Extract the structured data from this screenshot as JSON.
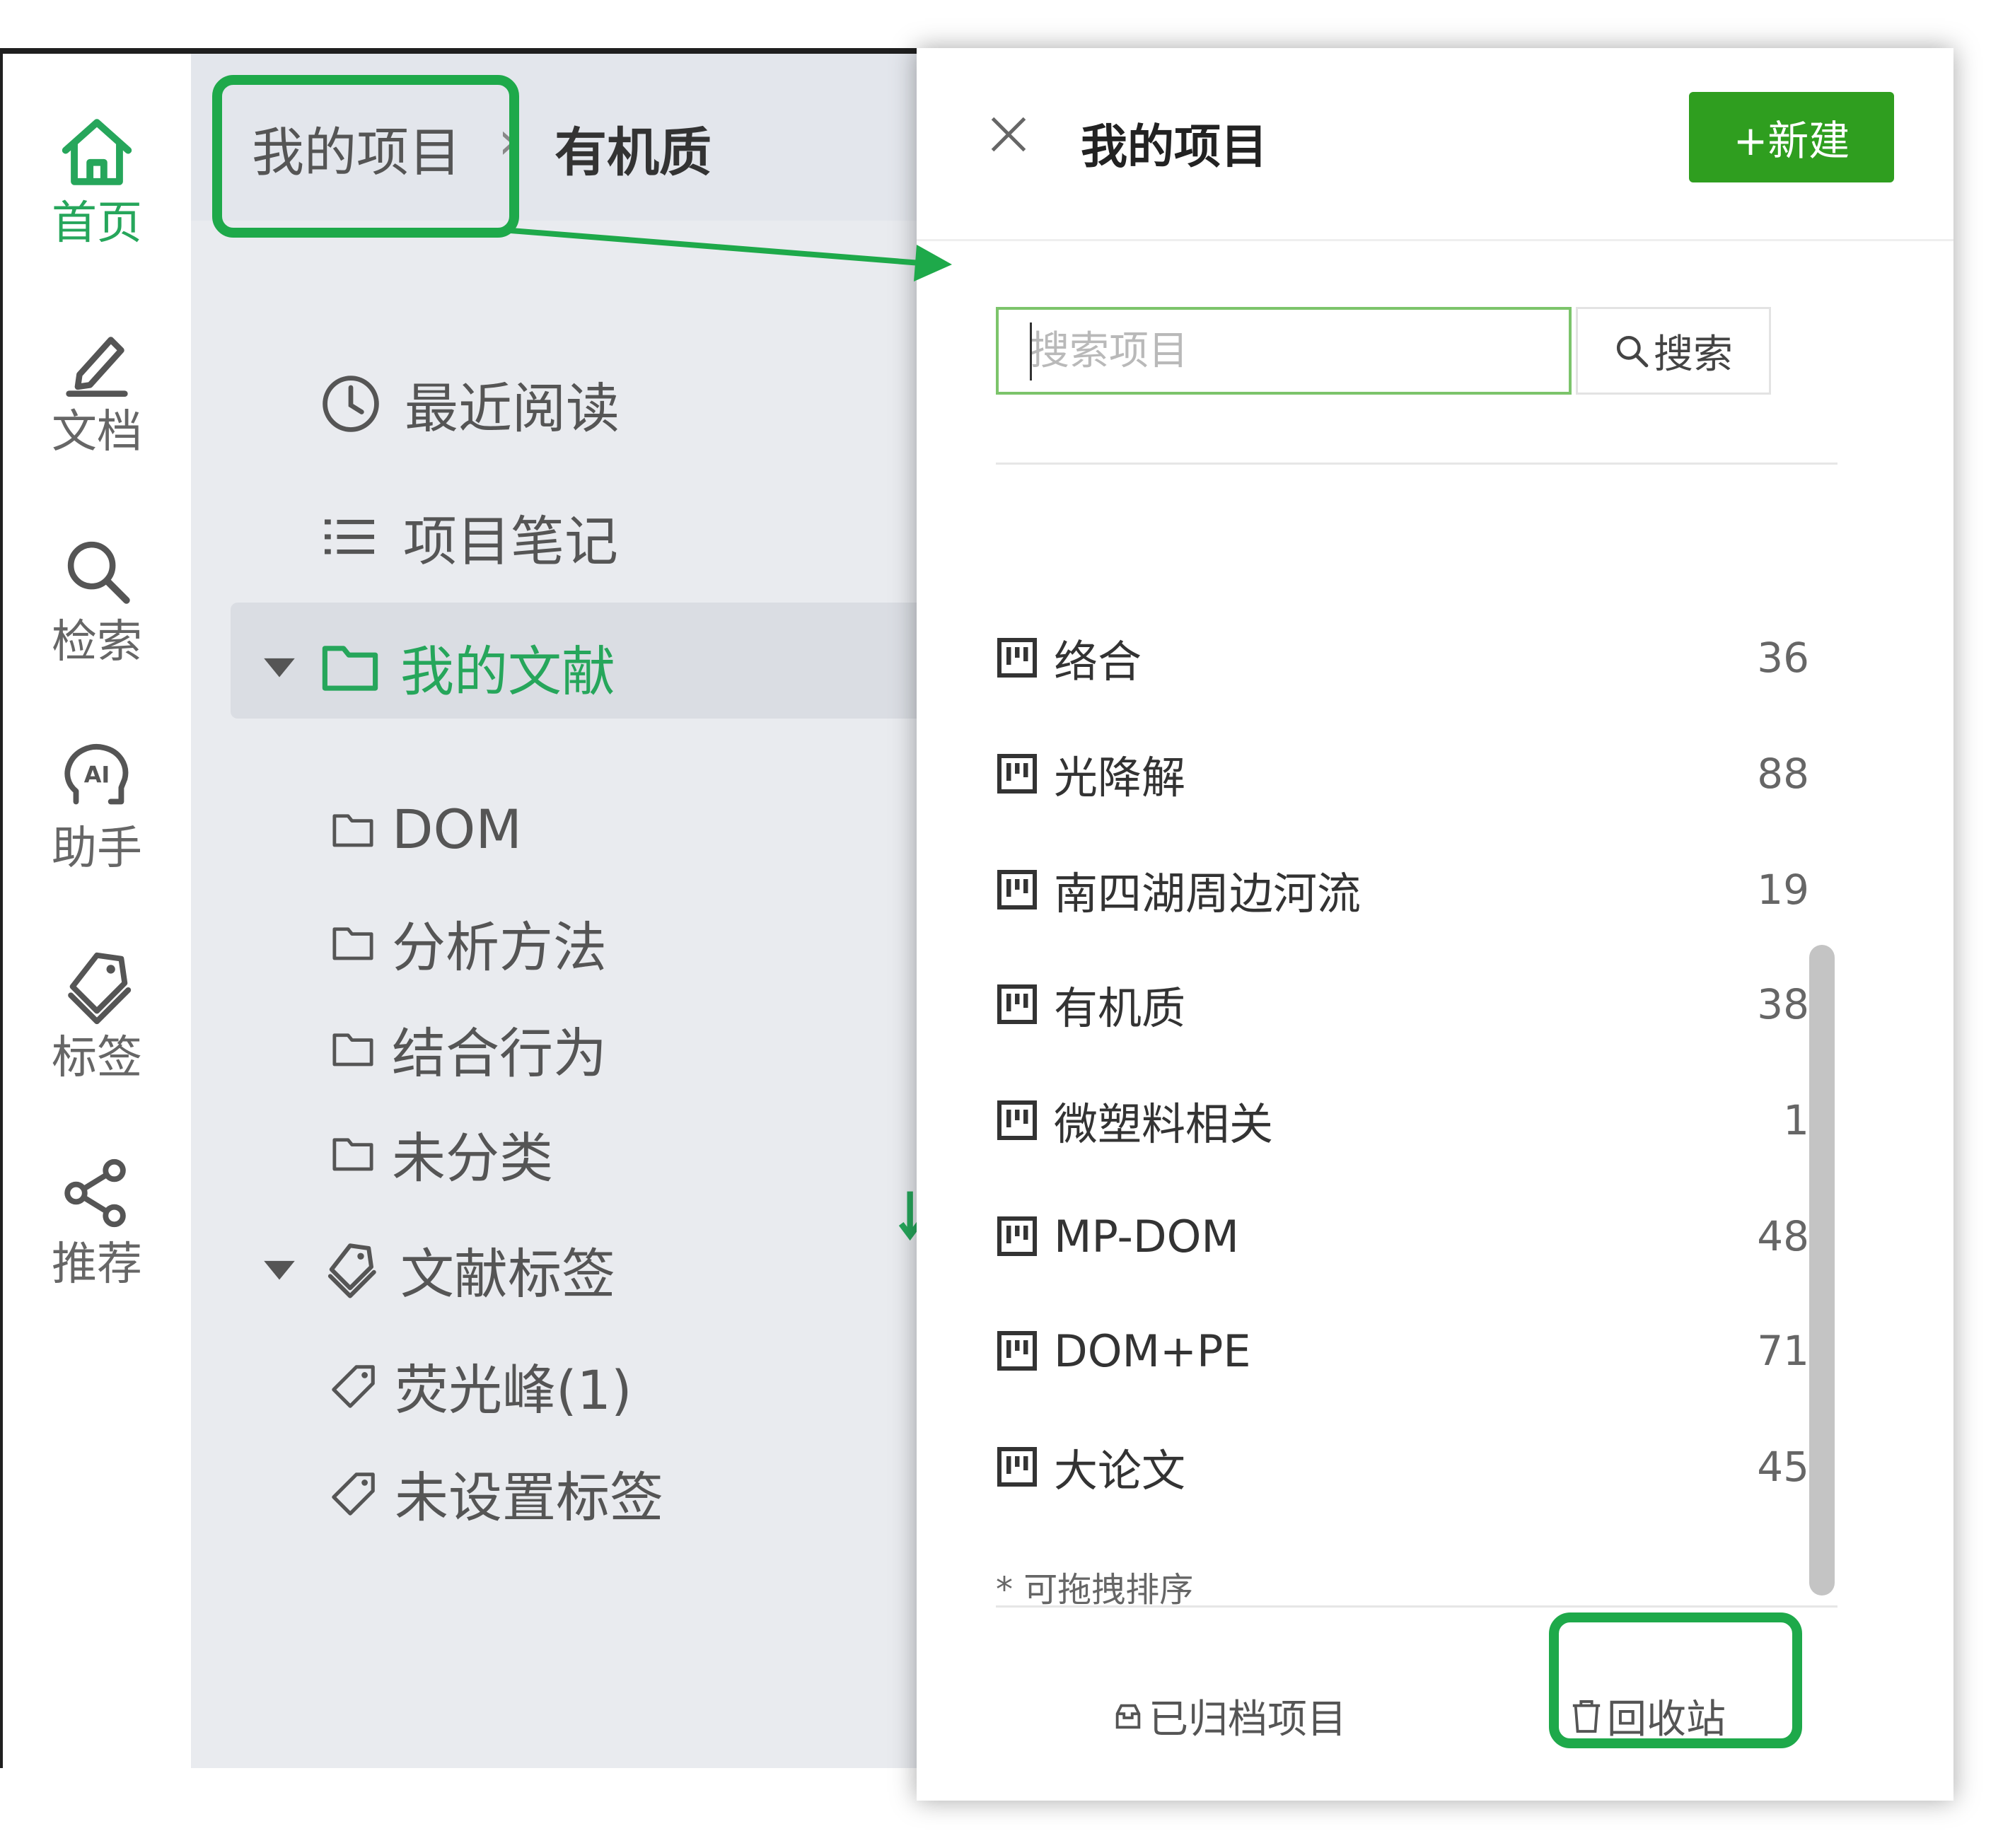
{
  "rail": {
    "items": [
      {
        "label": "首页",
        "icon": "home-icon"
      },
      {
        "label": "文档",
        "icon": "pencil-icon"
      },
      {
        "label": "检索",
        "icon": "search-icon"
      },
      {
        "label": "助手",
        "icon": "ai-head-icon"
      },
      {
        "label": "标签",
        "icon": "tags-icon"
      },
      {
        "label": "推荐",
        "icon": "share-icon"
      }
    ],
    "active_color": "#26a65b"
  },
  "breadcrumb": {
    "root": "我的项目",
    "separator": "›",
    "current": "有机质"
  },
  "tree": {
    "recent": "最近阅读",
    "notes": "项目笔记",
    "my_docs": "我的文献",
    "folders": [
      "DOM",
      "分析方法",
      "结合行为",
      "未分类"
    ],
    "doc_tags": "文献标签",
    "tags": [
      "荧光峰(1)",
      "未设置标签"
    ]
  },
  "panel": {
    "title": "我的项目",
    "new_button": "+新建",
    "search_placeholder": "搜索项目",
    "search_button": "搜索",
    "projects": [
      {
        "name": "络合",
        "count": "36"
      },
      {
        "name": "光降解",
        "count": "88"
      },
      {
        "name": "南四湖周边河流",
        "count": "19"
      },
      {
        "name": "有机质",
        "count": "38"
      },
      {
        "name": "微塑料相关",
        "count": "1"
      },
      {
        "name": "MP-DOM",
        "count": "48"
      },
      {
        "name": "DOM+PE",
        "count": "71"
      },
      {
        "name": "大论文",
        "count": "45"
      }
    ],
    "hint": "* 可拖拽排序",
    "archived": "已归档项目",
    "recycle": "回收站"
  },
  "colors": {
    "brand_green": "#2f9e1f",
    "highlight_green": "#1ea94a"
  }
}
